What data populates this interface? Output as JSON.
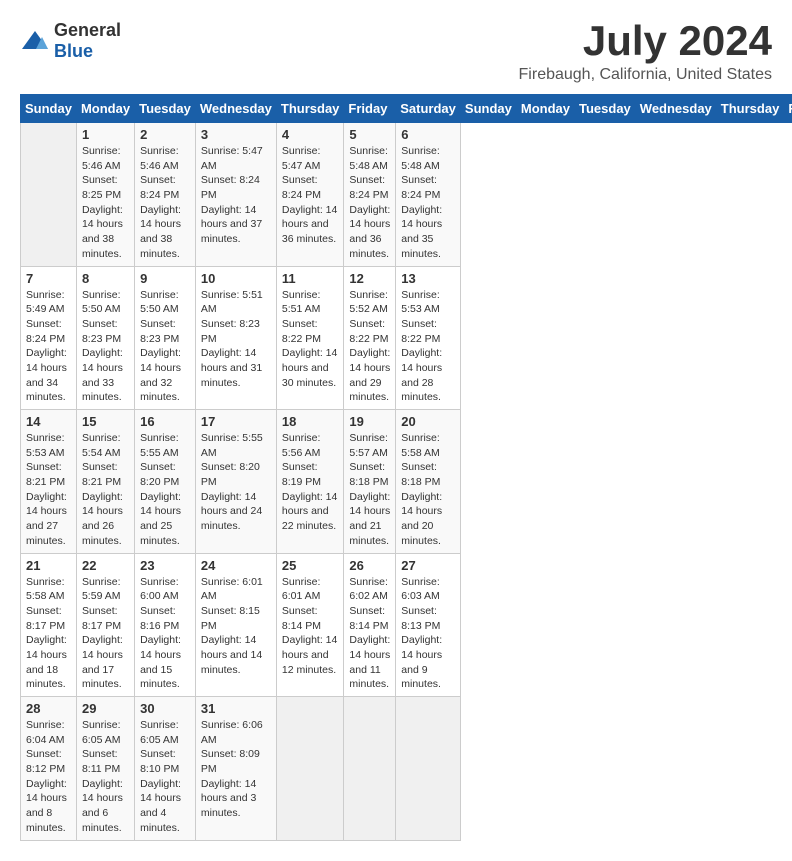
{
  "header": {
    "logo_general": "General",
    "logo_blue": "Blue",
    "month_title": "July 2024",
    "location": "Firebaugh, California, United States"
  },
  "calendar": {
    "days_of_week": [
      "Sunday",
      "Monday",
      "Tuesday",
      "Wednesday",
      "Thursday",
      "Friday",
      "Saturday"
    ],
    "weeks": [
      [
        {
          "day": "",
          "empty": true
        },
        {
          "day": "1",
          "sunrise": "Sunrise: 5:46 AM",
          "sunset": "Sunset: 8:25 PM",
          "daylight": "Daylight: 14 hours and 38 minutes."
        },
        {
          "day": "2",
          "sunrise": "Sunrise: 5:46 AM",
          "sunset": "Sunset: 8:24 PM",
          "daylight": "Daylight: 14 hours and 38 minutes."
        },
        {
          "day": "3",
          "sunrise": "Sunrise: 5:47 AM",
          "sunset": "Sunset: 8:24 PM",
          "daylight": "Daylight: 14 hours and 37 minutes."
        },
        {
          "day": "4",
          "sunrise": "Sunrise: 5:47 AM",
          "sunset": "Sunset: 8:24 PM",
          "daylight": "Daylight: 14 hours and 36 minutes."
        },
        {
          "day": "5",
          "sunrise": "Sunrise: 5:48 AM",
          "sunset": "Sunset: 8:24 PM",
          "daylight": "Daylight: 14 hours and 36 minutes."
        },
        {
          "day": "6",
          "sunrise": "Sunrise: 5:48 AM",
          "sunset": "Sunset: 8:24 PM",
          "daylight": "Daylight: 14 hours and 35 minutes."
        }
      ],
      [
        {
          "day": "7",
          "sunrise": "Sunrise: 5:49 AM",
          "sunset": "Sunset: 8:24 PM",
          "daylight": "Daylight: 14 hours and 34 minutes."
        },
        {
          "day": "8",
          "sunrise": "Sunrise: 5:50 AM",
          "sunset": "Sunset: 8:23 PM",
          "daylight": "Daylight: 14 hours and 33 minutes."
        },
        {
          "day": "9",
          "sunrise": "Sunrise: 5:50 AM",
          "sunset": "Sunset: 8:23 PM",
          "daylight": "Daylight: 14 hours and 32 minutes."
        },
        {
          "day": "10",
          "sunrise": "Sunrise: 5:51 AM",
          "sunset": "Sunset: 8:23 PM",
          "daylight": "Daylight: 14 hours and 31 minutes."
        },
        {
          "day": "11",
          "sunrise": "Sunrise: 5:51 AM",
          "sunset": "Sunset: 8:22 PM",
          "daylight": "Daylight: 14 hours and 30 minutes."
        },
        {
          "day": "12",
          "sunrise": "Sunrise: 5:52 AM",
          "sunset": "Sunset: 8:22 PM",
          "daylight": "Daylight: 14 hours and 29 minutes."
        },
        {
          "day": "13",
          "sunrise": "Sunrise: 5:53 AM",
          "sunset": "Sunset: 8:22 PM",
          "daylight": "Daylight: 14 hours and 28 minutes."
        }
      ],
      [
        {
          "day": "14",
          "sunrise": "Sunrise: 5:53 AM",
          "sunset": "Sunset: 8:21 PM",
          "daylight": "Daylight: 14 hours and 27 minutes."
        },
        {
          "day": "15",
          "sunrise": "Sunrise: 5:54 AM",
          "sunset": "Sunset: 8:21 PM",
          "daylight": "Daylight: 14 hours and 26 minutes."
        },
        {
          "day": "16",
          "sunrise": "Sunrise: 5:55 AM",
          "sunset": "Sunset: 8:20 PM",
          "daylight": "Daylight: 14 hours and 25 minutes."
        },
        {
          "day": "17",
          "sunrise": "Sunrise: 5:55 AM",
          "sunset": "Sunset: 8:20 PM",
          "daylight": "Daylight: 14 hours and 24 minutes."
        },
        {
          "day": "18",
          "sunrise": "Sunrise: 5:56 AM",
          "sunset": "Sunset: 8:19 PM",
          "daylight": "Daylight: 14 hours and 22 minutes."
        },
        {
          "day": "19",
          "sunrise": "Sunrise: 5:57 AM",
          "sunset": "Sunset: 8:18 PM",
          "daylight": "Daylight: 14 hours and 21 minutes."
        },
        {
          "day": "20",
          "sunrise": "Sunrise: 5:58 AM",
          "sunset": "Sunset: 8:18 PM",
          "daylight": "Daylight: 14 hours and 20 minutes."
        }
      ],
      [
        {
          "day": "21",
          "sunrise": "Sunrise: 5:58 AM",
          "sunset": "Sunset: 8:17 PM",
          "daylight": "Daylight: 14 hours and 18 minutes."
        },
        {
          "day": "22",
          "sunrise": "Sunrise: 5:59 AM",
          "sunset": "Sunset: 8:17 PM",
          "daylight": "Daylight: 14 hours and 17 minutes."
        },
        {
          "day": "23",
          "sunrise": "Sunrise: 6:00 AM",
          "sunset": "Sunset: 8:16 PM",
          "daylight": "Daylight: 14 hours and 15 minutes."
        },
        {
          "day": "24",
          "sunrise": "Sunrise: 6:01 AM",
          "sunset": "Sunset: 8:15 PM",
          "daylight": "Daylight: 14 hours and 14 minutes."
        },
        {
          "day": "25",
          "sunrise": "Sunrise: 6:01 AM",
          "sunset": "Sunset: 8:14 PM",
          "daylight": "Daylight: 14 hours and 12 minutes."
        },
        {
          "day": "26",
          "sunrise": "Sunrise: 6:02 AM",
          "sunset": "Sunset: 8:14 PM",
          "daylight": "Daylight: 14 hours and 11 minutes."
        },
        {
          "day": "27",
          "sunrise": "Sunrise: 6:03 AM",
          "sunset": "Sunset: 8:13 PM",
          "daylight": "Daylight: 14 hours and 9 minutes."
        }
      ],
      [
        {
          "day": "28",
          "sunrise": "Sunrise: 6:04 AM",
          "sunset": "Sunset: 8:12 PM",
          "daylight": "Daylight: 14 hours and 8 minutes."
        },
        {
          "day": "29",
          "sunrise": "Sunrise: 6:05 AM",
          "sunset": "Sunset: 8:11 PM",
          "daylight": "Daylight: 14 hours and 6 minutes."
        },
        {
          "day": "30",
          "sunrise": "Sunrise: 6:05 AM",
          "sunset": "Sunset: 8:10 PM",
          "daylight": "Daylight: 14 hours and 4 minutes."
        },
        {
          "day": "31",
          "sunrise": "Sunrise: 6:06 AM",
          "sunset": "Sunset: 8:09 PM",
          "daylight": "Daylight: 14 hours and 3 minutes."
        },
        {
          "day": "",
          "empty": true
        },
        {
          "day": "",
          "empty": true
        },
        {
          "day": "",
          "empty": true
        }
      ]
    ]
  }
}
